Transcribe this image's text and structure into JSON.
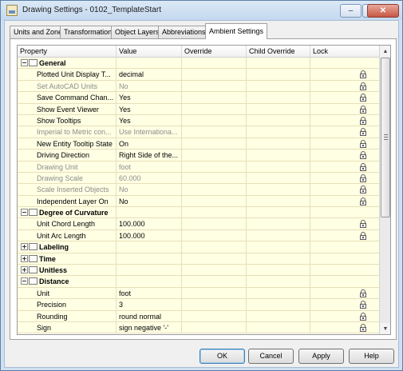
{
  "window": {
    "title": "Drawing Settings - 0102_TemplateStart",
    "minimize_glyph": "–",
    "maximize_glyph": "□",
    "close_glyph": "✕"
  },
  "tabs": [
    {
      "label": "Units and Zone",
      "active": false
    },
    {
      "label": "Transformation",
      "active": false
    },
    {
      "label": "Object Layers",
      "active": false
    },
    {
      "label": "Abbreviations",
      "active": false
    },
    {
      "label": "Ambient Settings",
      "active": true
    }
  ],
  "grid": {
    "columns": [
      "Property",
      "Value",
      "Override",
      "Child Override",
      "Lock"
    ],
    "rows": [
      {
        "type": "group",
        "expanded": true,
        "label": "General"
      },
      {
        "type": "prop",
        "label": "Plotted Unit Display T...",
        "value": "decimal",
        "lock": true,
        "disabled": false
      },
      {
        "type": "prop",
        "label": "Set AutoCAD Units",
        "value": "No",
        "lock": true,
        "disabled": true
      },
      {
        "type": "prop",
        "label": "Save Command Chan...",
        "value": "Yes",
        "lock": true,
        "disabled": false
      },
      {
        "type": "prop",
        "label": "Show Event Viewer",
        "value": "Yes",
        "lock": true,
        "disabled": false
      },
      {
        "type": "prop",
        "label": "Show Tooltips",
        "value": "Yes",
        "lock": true,
        "disabled": false
      },
      {
        "type": "prop",
        "label": "Imperial to Metric con...",
        "value": "Use Internationa...",
        "lock": true,
        "disabled": true
      },
      {
        "type": "prop",
        "label": "New Entity Tooltip State",
        "value": "On",
        "lock": true,
        "disabled": false
      },
      {
        "type": "prop",
        "label": "Driving Direction",
        "value": "Right Side of the...",
        "lock": true,
        "disabled": false
      },
      {
        "type": "prop",
        "label": "Drawing Unit",
        "value": "foot",
        "lock": true,
        "disabled": true
      },
      {
        "type": "prop",
        "label": "Drawing Scale",
        "value": "60.000",
        "lock": true,
        "disabled": true
      },
      {
        "type": "prop",
        "label": "Scale Inserted Objects",
        "value": "No",
        "lock": true,
        "disabled": true
      },
      {
        "type": "prop",
        "label": "Independent Layer On",
        "value": "No",
        "lock": true,
        "disabled": false
      },
      {
        "type": "group",
        "expanded": true,
        "label": "Degree of Curvature"
      },
      {
        "type": "prop",
        "label": "Unit Chord Length",
        "value": "100.000",
        "lock": true,
        "disabled": false
      },
      {
        "type": "prop",
        "label": "Unit Arc Length",
        "value": "100.000",
        "lock": true,
        "disabled": false
      },
      {
        "type": "group",
        "expanded": false,
        "label": "Labeling"
      },
      {
        "type": "group",
        "expanded": false,
        "label": "Time"
      },
      {
        "type": "group",
        "expanded": false,
        "label": "Unitless"
      },
      {
        "type": "group",
        "expanded": true,
        "label": "Distance"
      },
      {
        "type": "prop",
        "label": "Unit",
        "value": "foot",
        "lock": true,
        "disabled": false
      },
      {
        "type": "prop",
        "label": "Precision",
        "value": "3",
        "lock": true,
        "disabled": false
      },
      {
        "type": "prop",
        "label": "Rounding",
        "value": "round normal",
        "lock": true,
        "disabled": false
      },
      {
        "type": "prop",
        "label": "Sign",
        "value": "sign negative '-'",
        "lock": true,
        "disabled": false
      }
    ]
  },
  "buttons": {
    "ok": "OK",
    "cancel": "Cancel",
    "apply": "Apply",
    "help": "Help"
  },
  "scrollbar": {
    "up_glyph": "▲",
    "down_glyph": "▼"
  }
}
